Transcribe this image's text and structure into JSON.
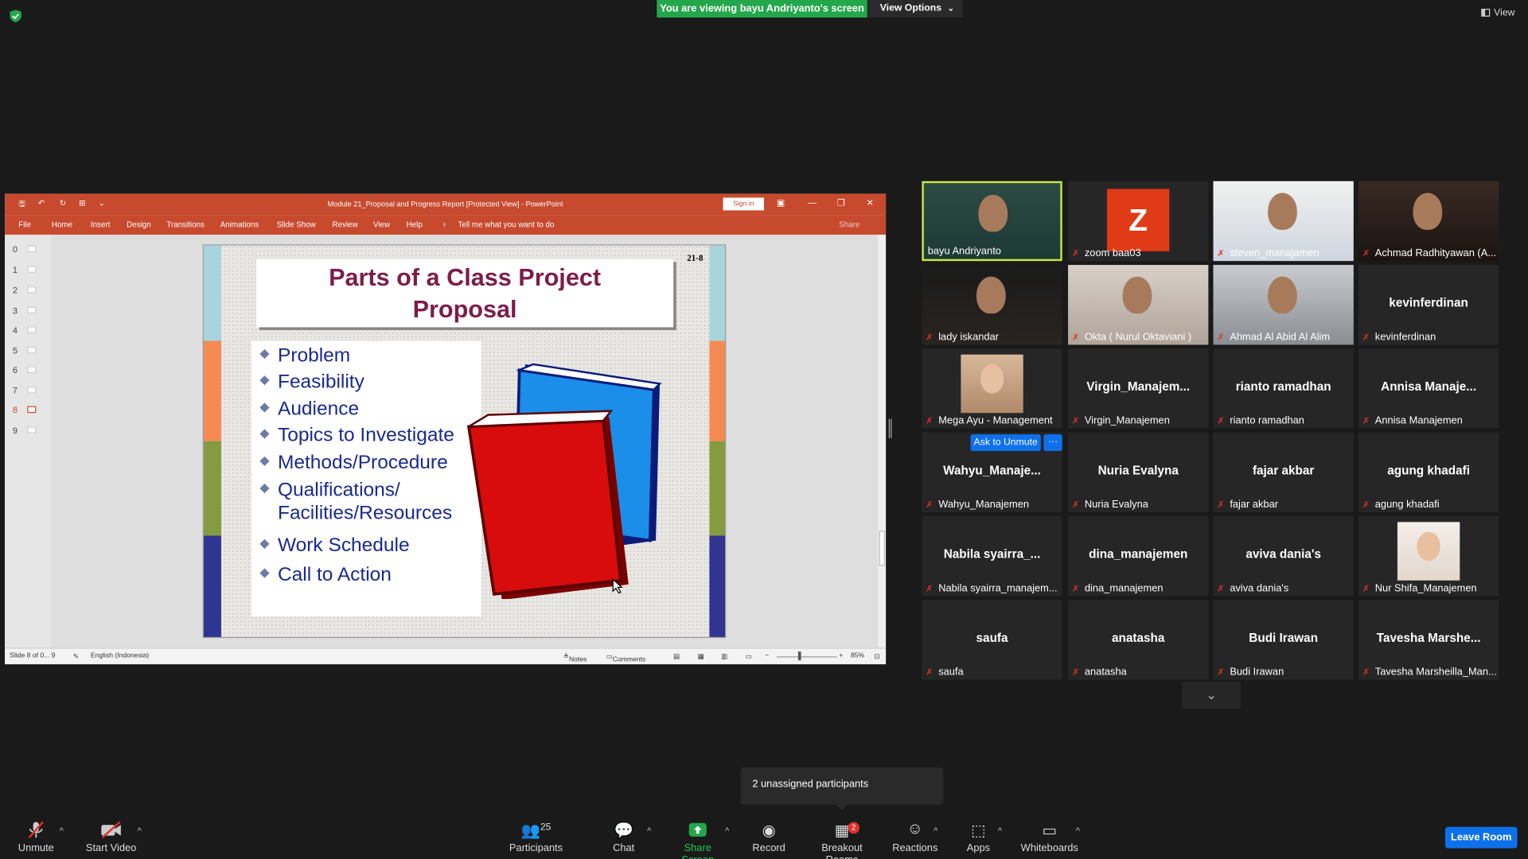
{
  "top": {
    "viewing_banner": "You are viewing bayu Andriyanto's screen",
    "view_options": "View Options",
    "view": "View"
  },
  "ppt": {
    "window_title": "Module 21_Proposal and Progress Report [Protected View]  -  PowerPoint",
    "sign_in": "Sign in",
    "tabs": [
      "File",
      "Home",
      "Insert",
      "Design",
      "Transitions",
      "Animations",
      "Slide Show",
      "Review",
      "View",
      "Help"
    ],
    "tell_me": "Tell me what you want to do",
    "share": "Share",
    "thumbnails": [
      "0",
      "1",
      "2",
      "3",
      "4",
      "5",
      "6",
      "7",
      "8",
      "9"
    ],
    "status": {
      "slide": "Slide 8 of 0... 9",
      "language": "English (Indonesia)",
      "notes": "Notes",
      "comments": "Comments",
      "zoom": "85%"
    },
    "slide": {
      "number": "21-8",
      "title_line1": "Parts of a Class Project",
      "title_line2": "Proposal",
      "bullets": [
        "Problem",
        "Feasibility",
        "Audience",
        "Topics to Investigate",
        "Methods/Procedure",
        "Qualifications/",
        "Facilities/Resources",
        "Work Schedule",
        "Call to Action"
      ]
    }
  },
  "participants": [
    {
      "name": "bayu Andriyanto",
      "big": "",
      "video": "person"
    },
    {
      "name": "zoom baa03",
      "big": "Z",
      "video": "avatar"
    },
    {
      "name": "steven_manajamen",
      "big": "",
      "video": "person2"
    },
    {
      "name": "Achmad Radhityawan (A...",
      "big": "",
      "video": "person3"
    },
    {
      "name": "lady iskandar",
      "big": "",
      "video": "person4"
    },
    {
      "name": "Okta ( Nurul Oktaviani )",
      "big": "",
      "video": "person5"
    },
    {
      "name": "Ahmad Al Abid Al Alim",
      "big": "",
      "video": "person6"
    },
    {
      "name": "kevinferdinan",
      "big": "kevinferdinan",
      "video": ""
    },
    {
      "name": "Mega Ayu - Management",
      "big": "",
      "video": "photo"
    },
    {
      "name": "Virgin_Manajemen",
      "big": "Virgin_Manajem...",
      "video": ""
    },
    {
      "name": "rianto ramadhan",
      "big": "rianto ramadhan",
      "video": ""
    },
    {
      "name": "Annisa Manajemen",
      "big": "Annisa  Manaje...",
      "video": ""
    },
    {
      "name": "Wahyu_Manajemen",
      "big": "Wahyu_Manaje...",
      "video": ""
    },
    {
      "name": "Nuria Evalyna",
      "big": "Nuria Evalyna",
      "video": ""
    },
    {
      "name": "fajar akbar",
      "big": "fajar akbar",
      "video": ""
    },
    {
      "name": "agung khadafi",
      "big": "agung khadafi",
      "video": ""
    },
    {
      "name": "Nabila syairra_manajem...",
      "big": "Nabila  syairra_...",
      "video": ""
    },
    {
      "name": "dina_manajemen",
      "big": "dina_manajemen",
      "video": ""
    },
    {
      "name": "aviva dania's",
      "big": "aviva dania's",
      "video": ""
    },
    {
      "name": "Nur Shifa_Manajemen",
      "big": "",
      "video": "photo2"
    },
    {
      "name": "saufa",
      "big": "saufa",
      "video": ""
    },
    {
      "name": "anatasha",
      "big": "anatasha",
      "video": ""
    },
    {
      "name": "Budi Irawan",
      "big": "Budi Irawan",
      "video": ""
    },
    {
      "name": "Tavesha Marsheilla_Man...",
      "big": "Tavesha  Marshe...",
      "video": ""
    }
  ],
  "ask_to_unmute": "Ask to Unmute",
  "tooltip": "2 unassigned participants",
  "toolbar": {
    "unmute": "Unmute",
    "start_video": "Start Video",
    "participants": "Participants",
    "participants_count": "25",
    "chat": "Chat",
    "share_screen": "Share Screen",
    "record": "Record",
    "breakout": "Breakout Rooms",
    "breakout_badge": "2",
    "reactions": "Reactions",
    "apps": "Apps",
    "whiteboards": "Whiteboards",
    "leave": "Leave Room"
  }
}
